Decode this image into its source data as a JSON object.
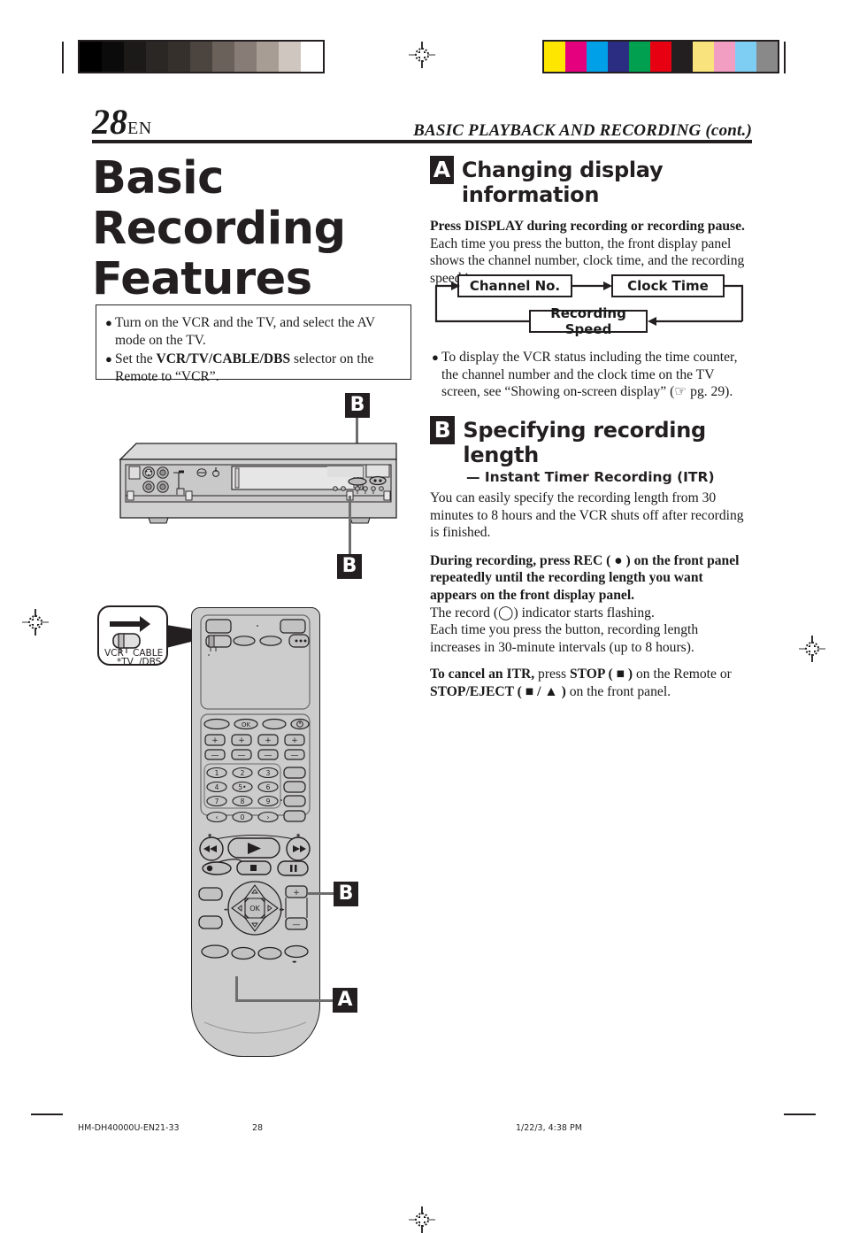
{
  "page": {
    "number": "28",
    "lang_code": "EN",
    "running_head": "BASIC PLAYBACK AND RECORDING (cont.)",
    "title_line1": "Basic",
    "title_line2": "Recording",
    "title_line3": "Features"
  },
  "prep_notes": {
    "bullet_marker": "●",
    "items": [
      {
        "text_before": "Turn on the VCR and the TV, and select the AV mode on the TV.",
        "bold": "",
        "text_after": ""
      },
      {
        "text_before": "Set the ",
        "bold": "VCR/TV/CABLE/DBS",
        "text_after": " selector on the Remote to “VCR”."
      }
    ]
  },
  "section_a": {
    "badge": "A",
    "heading": "Changing display information",
    "lead_bold": "Press DISPLAY during recording or recording pause.",
    "body": "Each time you press the button, the front display panel shows the channel number, clock time, and the recording speed in sequence.",
    "flow": {
      "box1": "Channel No.",
      "box2": "Clock Time",
      "box3": "Recording Speed"
    },
    "note_marker": "●",
    "note": "To display the VCR status including the time counter, the channel number and the clock time on the TV screen, see “Showing on-screen display” (☞ pg. 29)."
  },
  "section_b": {
    "badge": "B",
    "heading": "Specifying recording length",
    "subheading": "— Instant Timer Recording (ITR)",
    "intro": "You can easily specify the recording length from 30 minutes to 8 hours and the VCR shuts off after recording is finished.",
    "step_bold": "During recording, press REC ( ● ) on the front panel repeatedly until the recording length you want appears on the front display panel.",
    "step_line1": "The record (◯) indicator starts flashing.",
    "step_line2": "Each time you press the button, recording length increases in 30-minute intervals (up to 8 hours).",
    "cancel_bold1": "To cancel an ITR,",
    "cancel_mid1": " press ",
    "cancel_bold2": "STOP ( ■ )",
    "cancel_mid2": " on the Remote or ",
    "cancel_bold3": "STOP/EJECT ( ■ / ▲ )",
    "cancel_tail": " on the front panel."
  },
  "callouts": {
    "vcr_top": "B",
    "vcr_bottom": "B",
    "remote_pause": "B",
    "remote_display": "A"
  },
  "remote": {
    "selector_bubble": {
      "label_vcr": "VCR",
      "label_tv": "*TV",
      "label_cable": "CABLE",
      "label_dbs": "/DBS"
    },
    "ok_label": "OK",
    "power_label": "⏻",
    "plus": "+",
    "minus": "−",
    "numbers": [
      "1",
      "2",
      "3",
      "4",
      "5•",
      "6",
      "7",
      "8",
      "9"
    ],
    "zero": "0",
    "left_arrow": "‹",
    "right_arrow": "›",
    "nav_up": "△",
    "nav_down": "▽",
    "nav_left": "◁",
    "nav_right": "▷",
    "play": "▶",
    "stop": "■",
    "rec": "●",
    "pause": "‖",
    "rew": "◀◀",
    "ff": "▶▶"
  },
  "footer": {
    "file_id": "HM-DH40000U-EN21-33",
    "page_num": "28",
    "timestamp": "1/22/3, 4:38 PM"
  },
  "colors": {
    "ink": "#231f20",
    "gray_ramp": [
      "#000000",
      "#0b0b0b",
      "#1c1a18",
      "#2b2724",
      "#35302c",
      "#4b443f",
      "#6a615b",
      "#877d76",
      "#a79d95",
      "#cfc7bf",
      "#ffffff"
    ],
    "color_bar": [
      "#ffe600",
      "#e5007e",
      "#00a0e9",
      "#2b2d83",
      "#00a050",
      "#e60012",
      "#231f20",
      "#f9e37c",
      "#f19ec2",
      "#7ecef4",
      "#898989"
    ]
  }
}
